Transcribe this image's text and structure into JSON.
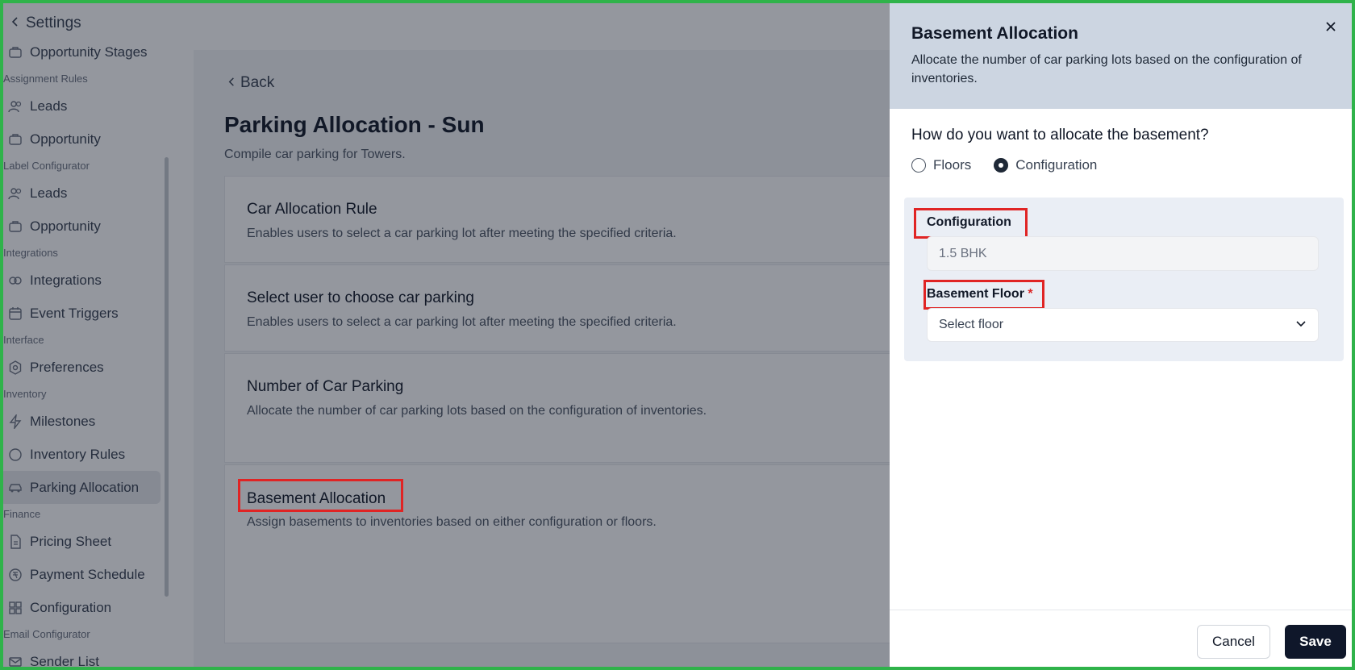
{
  "sidebar": {
    "back_label": "Settings",
    "items": [
      {
        "type": "item",
        "label": "Opportunity Stages",
        "icon": "briefcase-icon"
      },
      {
        "type": "section",
        "label": "Assignment Rules"
      },
      {
        "type": "item",
        "label": "Leads",
        "icon": "users-icon"
      },
      {
        "type": "item",
        "label": "Opportunity",
        "icon": "briefcase-icon"
      },
      {
        "type": "section",
        "label": "Label Configurator"
      },
      {
        "type": "item",
        "label": "Leads",
        "icon": "users-icon"
      },
      {
        "type": "item",
        "label": "Opportunity",
        "icon": "briefcase-icon"
      },
      {
        "type": "section",
        "label": "Integrations"
      },
      {
        "type": "item",
        "label": "Integrations",
        "icon": "link-icon"
      },
      {
        "type": "item",
        "label": "Event Triggers",
        "icon": "calendar-icon"
      },
      {
        "type": "section",
        "label": "Interface"
      },
      {
        "type": "item",
        "label": "Preferences",
        "icon": "gear-icon"
      },
      {
        "type": "section",
        "label": "Inventory"
      },
      {
        "type": "item",
        "label": "Milestones",
        "icon": "lightning-icon"
      },
      {
        "type": "item",
        "label": "Inventory Rules",
        "icon": "circle-icon"
      },
      {
        "type": "item",
        "label": "Parking Allocation",
        "icon": "car-icon",
        "active": true
      },
      {
        "type": "section",
        "label": "Finance"
      },
      {
        "type": "item",
        "label": "Pricing Sheet",
        "icon": "document-icon"
      },
      {
        "type": "item",
        "label": "Payment Schedule",
        "icon": "money-icon"
      },
      {
        "type": "item",
        "label": "Configuration",
        "icon": "grid-icon"
      },
      {
        "type": "section",
        "label": "Email Configurator"
      },
      {
        "type": "item",
        "label": "Sender List",
        "icon": "mail-icon"
      }
    ]
  },
  "main": {
    "back_label": "Back",
    "title": "Parking Allocation - Sun",
    "subtitle": "Compile car parking for Towers.",
    "cards": [
      {
        "title": "Car Allocation Rule",
        "desc": "Enables users to select a car parking lot after meeting the specified criteria."
      },
      {
        "title": "Select user to choose car parking",
        "desc": "Enables users to select a car parking lot after meeting the specified criteria."
      },
      {
        "title": "Number of Car Parking",
        "desc": "Allocate the number of car parking lots based on the configuration of inventories."
      },
      {
        "title": "Basement Allocation",
        "desc": "Assign basements to inventories based on either configuration or floors."
      }
    ]
  },
  "drawer": {
    "title": "Basement Allocation",
    "description": "Allocate the number of car parking lots based on the configuration of inventories.",
    "question": "How do you want to allocate the basement?",
    "options": [
      {
        "label": "Floors",
        "checked": false
      },
      {
        "label": "Configuration",
        "checked": true
      }
    ],
    "configuration_label": "Configuration",
    "configuration_value": "1.5 BHK",
    "basement_floor_label": "Basement Floor",
    "required_mark": "*",
    "basement_floor_placeholder": "Select floor",
    "cancel_label": "Cancel",
    "save_label": "Save"
  },
  "colors": {
    "highlight_box": "#e02424",
    "frame": "#2fb34a",
    "drawer_header": "#ccd5e1",
    "primary_button": "#0f172a"
  }
}
